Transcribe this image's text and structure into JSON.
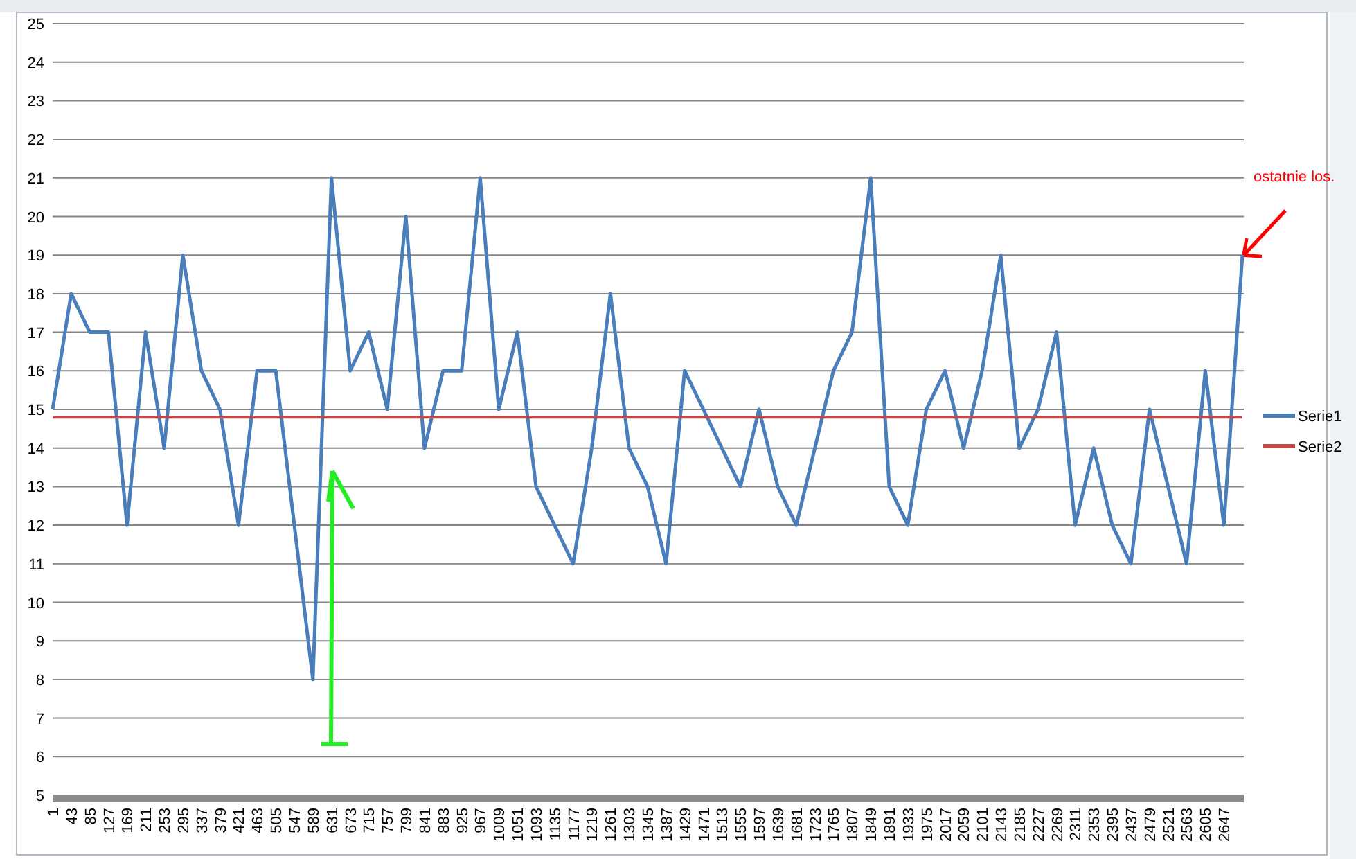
{
  "chart": {
    "chart_data": {
      "type": "line",
      "x": [
        1,
        43,
        85,
        127,
        169,
        211,
        253,
        295,
        337,
        379,
        421,
        463,
        505,
        547,
        589,
        631,
        673,
        715,
        757,
        799,
        841,
        883,
        925,
        967,
        1009,
        1051,
        1093,
        1135,
        1177,
        1219,
        1261,
        1303,
        1345,
        1387,
        1429,
        1471,
        1513,
        1555,
        1597,
        1639,
        1681,
        1723,
        1765,
        1807,
        1849,
        1891,
        1933,
        1975,
        2017,
        2059,
        2101,
        2143,
        2185,
        2227,
        2269,
        2311,
        2353,
        2395,
        2437,
        2479,
        2521,
        2563,
        2605,
        2647,
        2689
      ],
      "series": [
        {
          "name": "Serie1",
          "color": "#4a7ebb",
          "values": [
            15,
            18,
            17,
            17,
            12,
            17,
            14,
            19,
            16,
            15,
            12,
            16,
            16,
            12,
            8,
            21,
            16,
            17,
            15,
            20,
            14,
            16,
            16,
            21,
            15,
            17,
            13,
            12,
            11,
            14,
            18,
            14,
            13,
            11,
            16,
            15,
            14,
            13,
            15,
            13,
            12,
            14,
            16,
            17,
            21,
            13,
            12,
            15,
            16,
            14,
            16,
            19,
            14,
            15,
            17,
            12,
            14,
            12,
            11,
            15,
            13,
            11,
            16,
            12,
            19
          ]
        },
        {
          "name": "Serie2",
          "color": "#be4b48",
          "values": [
            14.8,
            14.8,
            14.8,
            14.8,
            14.8,
            14.8,
            14.8,
            14.8,
            14.8,
            14.8,
            14.8,
            14.8,
            14.8,
            14.8,
            14.8,
            14.8,
            14.8,
            14.8,
            14.8,
            14.8,
            14.8,
            14.8,
            14.8,
            14.8,
            14.8,
            14.8,
            14.8,
            14.8,
            14.8,
            14.8,
            14.8,
            14.8,
            14.8,
            14.8,
            14.8,
            14.8,
            14.8,
            14.8,
            14.8,
            14.8,
            14.8,
            14.8,
            14.8,
            14.8,
            14.8,
            14.8,
            14.8,
            14.8,
            14.8,
            14.8,
            14.8,
            14.8,
            14.8,
            14.8,
            14.8,
            14.8,
            14.8,
            14.8,
            14.8,
            14.8,
            14.8,
            14.8,
            14.8,
            14.8,
            14.8
          ]
        }
      ],
      "xlim": [
        1,
        2689
      ],
      "ylim": [
        5,
        25
      ],
      "grid": "y",
      "legend": "right",
      "yticks": [
        5,
        6,
        7,
        8,
        9,
        10,
        11,
        12,
        13,
        14,
        15,
        16,
        17,
        18,
        19,
        20,
        21,
        22,
        23,
        24,
        25
      ],
      "xticks": [
        1,
        43,
        85,
        127,
        169,
        211,
        253,
        295,
        337,
        379,
        421,
        463,
        505,
        547,
        589,
        631,
        673,
        715,
        757,
        799,
        841,
        883,
        925,
        967,
        1009,
        1051,
        1093,
        1135,
        1177,
        1219,
        1261,
        1303,
        1345,
        1387,
        1429,
        1471,
        1513,
        1555,
        1597,
        1639,
        1681,
        1723,
        1765,
        1807,
        1849,
        1891,
        1933,
        1975,
        2017,
        2059,
        2101,
        2143,
        2185,
        2227,
        2269,
        2311,
        2353,
        2395,
        2437,
        2479,
        2521,
        2563,
        2605,
        2647
      ],
      "annotations": [
        "ostatnie los."
      ]
    }
  }
}
